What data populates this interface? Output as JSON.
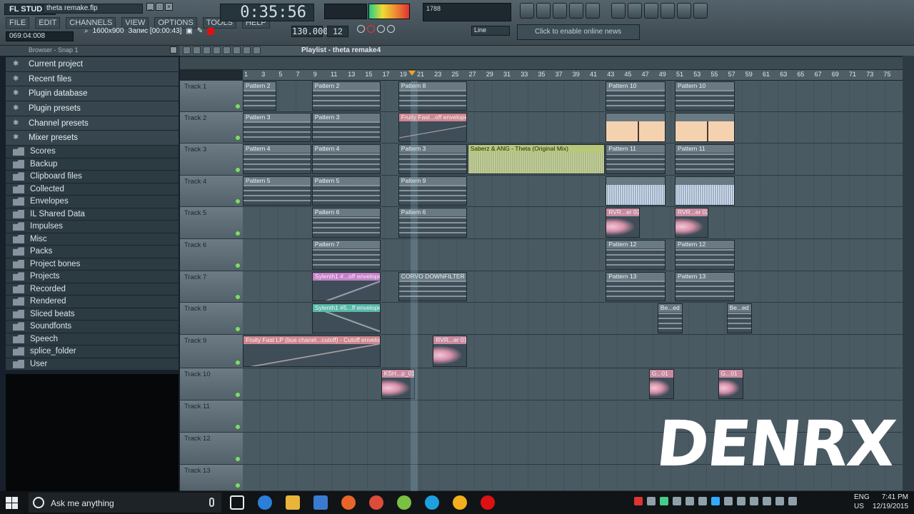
{
  "app": {
    "logo": "FL STUDIO",
    "filename": "theta remake.flp"
  },
  "menu": [
    "FILE",
    "EDIT",
    "CHANNELS",
    "VIEW",
    "OPTIONS",
    "TOOLS",
    "HELP"
  ],
  "hint_bar": "069:04:008",
  "recorder": {
    "resolution": "1600x900",
    "record_label": "Запис [00:00:43]"
  },
  "transport": {
    "time": "0:35:56",
    "tempo": "130.000",
    "step": "12",
    "snap": "Line",
    "cpu_label": "1788"
  },
  "online": {
    "label": "Click to enable online news"
  },
  "browser": {
    "title": "Browser - Snap 1",
    "items": [
      {
        "label": "Current project",
        "highlight": true
      },
      {
        "label": "Recent files",
        "highlight": true
      },
      {
        "label": "Plugin database",
        "highlight": true
      },
      {
        "label": "Plugin presets",
        "highlight": true
      },
      {
        "label": "Channel presets",
        "highlight": true
      },
      {
        "label": "Mixer presets",
        "highlight": true
      },
      {
        "label": "Scores",
        "highlight": false
      },
      {
        "label": "Backup",
        "highlight": false
      },
      {
        "label": "Clipboard files",
        "highlight": false
      },
      {
        "label": "Collected",
        "highlight": false
      },
      {
        "label": "Envelopes",
        "highlight": false
      },
      {
        "label": "IL Shared Data",
        "highlight": false
      },
      {
        "label": "Impulses",
        "highlight": false
      },
      {
        "label": "Misc",
        "highlight": false
      },
      {
        "label": "Packs",
        "highlight": false
      },
      {
        "label": "Project bones",
        "highlight": false
      },
      {
        "label": "Projects",
        "highlight": false
      },
      {
        "label": "Recorded",
        "highlight": false
      },
      {
        "label": "Rendered",
        "highlight": false
      },
      {
        "label": "Sliced beats",
        "highlight": false
      },
      {
        "label": "Soundfonts",
        "highlight": false
      },
      {
        "label": "Speech",
        "highlight": false
      },
      {
        "label": "splice_folder",
        "highlight": false
      },
      {
        "label": "User",
        "highlight": false
      }
    ]
  },
  "playlist": {
    "title": "Playlist - theta remake4",
    "ruler": [
      "1",
      "3",
      "5",
      "7",
      "9",
      "11",
      "13",
      "15",
      "17",
      "19",
      "21",
      "23",
      "25",
      "27",
      "29",
      "31",
      "33",
      "35",
      "37",
      "39",
      "41",
      "43",
      "45",
      "47",
      "49",
      "51",
      "53",
      "55",
      "57",
      "59",
      "61",
      "63",
      "65",
      "67",
      "69",
      "71",
      "73",
      "75"
    ],
    "tracks": [
      "Track 1",
      "Track 2",
      "Track 3",
      "Track 4",
      "Track 5",
      "Track 6",
      "Track 7",
      "Track 8",
      "Track 9",
      "Track 10",
      "Track 11",
      "Track 12",
      "Track 13"
    ],
    "clips": [
      {
        "track": 0,
        "bar": 1,
        "len": 4,
        "label": "Pattern 2",
        "kind": "pattern"
      },
      {
        "track": 0,
        "bar": 9,
        "len": 8,
        "label": "Pattern 2",
        "kind": "pattern"
      },
      {
        "track": 0,
        "bar": 19,
        "len": 8,
        "label": "Pattern 8",
        "kind": "pattern"
      },
      {
        "track": 0,
        "bar": 43,
        "len": 7,
        "label": "Pattern 10",
        "kind": "pattern"
      },
      {
        "track": 0,
        "bar": 51,
        "len": 7,
        "label": "Pattern 10",
        "kind": "pattern"
      },
      {
        "track": 1,
        "bar": 1,
        "len": 8,
        "label": "Pattern 3",
        "kind": "pattern"
      },
      {
        "track": 1,
        "bar": 9,
        "len": 8,
        "label": "Pattern 3",
        "kind": "pattern"
      },
      {
        "track": 1,
        "bar": 19,
        "len": 8,
        "label": "Fruity Fast...off envelope",
        "kind": "fruity"
      },
      {
        "track": 1,
        "bar": 43,
        "len": 7,
        "label": "",
        "kind": "orange"
      },
      {
        "track": 1,
        "bar": 51,
        "len": 7,
        "label": "",
        "kind": "orange"
      },
      {
        "track": 2,
        "bar": 1,
        "len": 8,
        "label": "Pattern 4",
        "kind": "pattern"
      },
      {
        "track": 2,
        "bar": 9,
        "len": 8,
        "label": "Pattern 4",
        "kind": "pattern"
      },
      {
        "track": 2,
        "bar": 19,
        "len": 8,
        "label": "Pattern 3",
        "kind": "pattern"
      },
      {
        "track": 2,
        "bar": 27,
        "len": 16,
        "label": "Saberz & ANG - Theta (Original Mix)",
        "kind": "saber"
      },
      {
        "track": 2,
        "bar": 43,
        "len": 7,
        "label": "Pattern 11",
        "kind": "pattern"
      },
      {
        "track": 2,
        "bar": 51,
        "len": 7,
        "label": "Pattern 11",
        "kind": "pattern"
      },
      {
        "track": 3,
        "bar": 1,
        "len": 8,
        "label": "Pattern 5",
        "kind": "pattern"
      },
      {
        "track": 3,
        "bar": 9,
        "len": 8,
        "label": "Pattern 5",
        "kind": "pattern"
      },
      {
        "track": 3,
        "bar": 19,
        "len": 8,
        "label": "Pattern 9",
        "kind": "pattern"
      },
      {
        "track": 3,
        "bar": 43,
        "len": 7,
        "label": "",
        "kind": "lightblue"
      },
      {
        "track": 3,
        "bar": 51,
        "len": 7,
        "label": "",
        "kind": "lightblue"
      },
      {
        "track": 4,
        "bar": 9,
        "len": 8,
        "label": "Pattern 6",
        "kind": "pattern"
      },
      {
        "track": 4,
        "bar": 19,
        "len": 8,
        "label": "Pattern 6",
        "kind": "pattern"
      },
      {
        "track": 4,
        "bar": 43,
        "len": 4,
        "label": "RVR...er 02",
        "kind": "audio"
      },
      {
        "track": 4,
        "bar": 51,
        "len": 4,
        "label": "RVR...er 02",
        "kind": "audio"
      },
      {
        "track": 5,
        "bar": 9,
        "len": 8,
        "label": "Pattern 7",
        "kind": "pattern"
      },
      {
        "track": 5,
        "bar": 43,
        "len": 7,
        "label": "Pattern 12",
        "kind": "pattern"
      },
      {
        "track": 5,
        "bar": 51,
        "len": 7,
        "label": "Pattern 12",
        "kind": "pattern"
      },
      {
        "track": 6,
        "bar": 9,
        "len": 8,
        "label": "Sylenth1 #...off envelope",
        "kind": "env"
      },
      {
        "track": 6,
        "bar": 19,
        "len": 8,
        "label": "CORVO DOWNFILTER",
        "kind": "pattern"
      },
      {
        "track": 6,
        "bar": 43,
        "len": 7,
        "label": "Pattern 13",
        "kind": "pattern"
      },
      {
        "track": 6,
        "bar": 51,
        "len": 7,
        "label": "Pattern 13",
        "kind": "pattern"
      },
      {
        "track": 7,
        "bar": 9,
        "len": 8,
        "label": "Sylenth1 #5...ff envelope",
        "kind": "env2"
      },
      {
        "track": 7,
        "bar": 49,
        "len": 3,
        "label": "Be...ed",
        "kind": "pattern"
      },
      {
        "track": 7,
        "bar": 57,
        "len": 3,
        "label": "Be...ed",
        "kind": "pattern"
      },
      {
        "track": 8,
        "bar": 1,
        "len": 16,
        "label": "Fruity Fast LP (bus chanel...cutoff) - Cutoff envelope",
        "kind": "fruity"
      },
      {
        "track": 8,
        "bar": 23,
        "len": 4,
        "label": "RVR...er 01",
        "kind": "audio"
      },
      {
        "track": 9,
        "bar": 17,
        "len": 4,
        "label": "KSH...p_01",
        "kind": "audio"
      },
      {
        "track": 9,
        "bar": 48,
        "len": 3,
        "label": "G...01",
        "kind": "audio"
      },
      {
        "track": 9,
        "bar": 56,
        "len": 3,
        "label": "G...01",
        "kind": "audio"
      }
    ]
  },
  "watermark": "DENRX",
  "taskbar": {
    "search_placeholder": "Ask me anything",
    "lang1": "ENG",
    "lang2": "US",
    "time": "7:41 PM",
    "date": "12/19/2015"
  },
  "colors": {
    "accent": "#f3a41e",
    "playlist_bg": "#4a5a63"
  }
}
